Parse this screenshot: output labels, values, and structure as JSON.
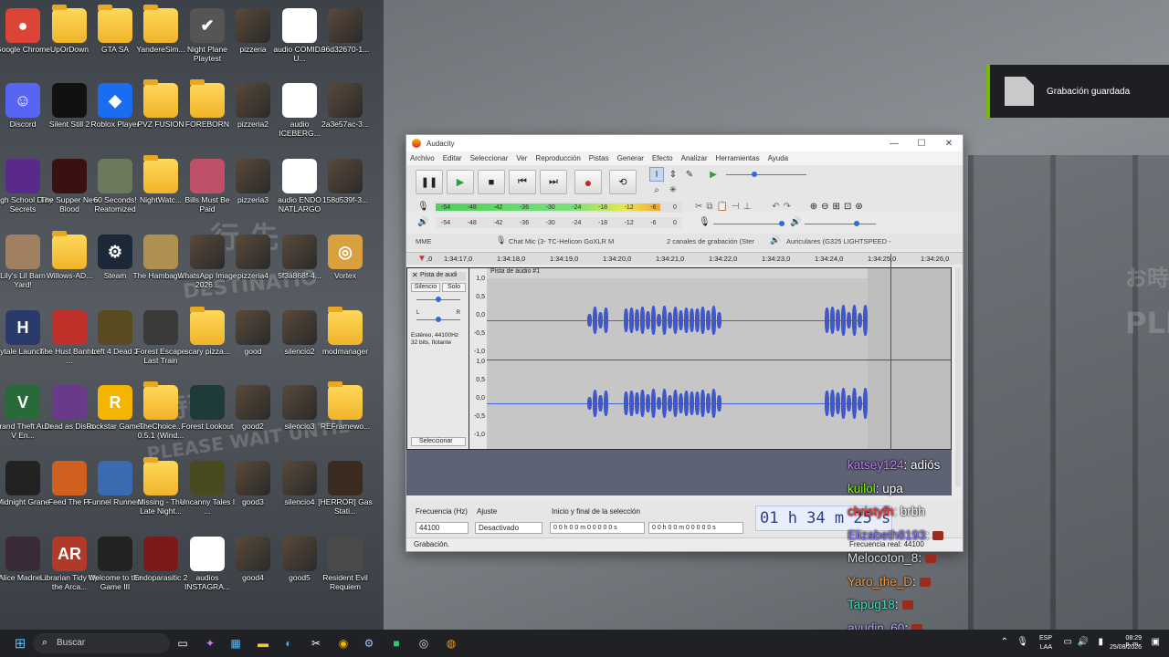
{
  "wallpaper": {
    "sign_1": "行 先",
    "sign_2": "DESTINATIO",
    "sign_3": "PLEASE WAIT UNTIL",
    "sign_4": "時刻",
    "sign_5": "PLE",
    "sign_6": "お時"
  },
  "desktop_icons": [
    {
      "label": "Google Chrome",
      "icon": "chrome-icon",
      "glyph": "●",
      "color": "#db4437"
    },
    {
      "label": "UpOrDown",
      "icon": "folder-icon",
      "glyph": "",
      "color": ""
    },
    {
      "label": "GTA SA",
      "icon": "folder-icon",
      "glyph": "",
      "color": ""
    },
    {
      "label": "YandereSim...",
      "icon": "folder-icon",
      "glyph": "",
      "color": ""
    },
    {
      "label": "Night Plane Playtest",
      "icon": "checkmark-icon",
      "glyph": "✔",
      "color": "#555555"
    },
    {
      "label": "pizzeria",
      "icon": "image-thumbnail-icon",
      "glyph": "",
      "color": ""
    },
    {
      "label": "audio COMIDA U...",
      "icon": "media-file-icon",
      "glyph": "▶",
      "color": ""
    },
    {
      "label": "96d32670-1...",
      "icon": "image-thumbnail-icon",
      "glyph": "",
      "color": ""
    },
    {
      "label": "Discord",
      "icon": "discord-icon",
      "glyph": "☺",
      "color": "#5865f2"
    },
    {
      "label": "Silent Still 2",
      "icon": "game-icon",
      "glyph": "",
      "color": "#111111"
    },
    {
      "label": "Roblox Player",
      "icon": "roblox-icon",
      "glyph": "◆",
      "color": "#1a6cf0"
    },
    {
      "label": "PVZ FUSION",
      "icon": "folder-icon",
      "glyph": "",
      "color": ""
    },
    {
      "label": "FOREBORN",
      "icon": "folder-icon",
      "glyph": "",
      "color": ""
    },
    {
      "label": "pizzeria2",
      "icon": "image-thumbnail-icon",
      "glyph": "",
      "color": ""
    },
    {
      "label": "audio ICEBERG...",
      "icon": "media-file-icon",
      "glyph": "▶",
      "color": ""
    },
    {
      "label": "2a3e57ac-3...",
      "icon": "image-thumbnail-icon",
      "glyph": "",
      "color": ""
    },
    {
      "label": "High School Dirty Secrets",
      "icon": "game-icon",
      "glyph": "",
      "color": "#5a2a8a"
    },
    {
      "label": "The Supper New Blood",
      "icon": "game-icon",
      "glyph": "",
      "color": "#3a1010"
    },
    {
      "label": "60 Seconds! Reatomized",
      "icon": "game-icon",
      "glyph": "",
      "color": "#6a7a5a"
    },
    {
      "label": "NightWatc...",
      "icon": "folder-icon",
      "glyph": "",
      "color": ""
    },
    {
      "label": "Bills Must Be Paid",
      "icon": "game-icon",
      "glyph": "",
      "color": "#c0506a"
    },
    {
      "label": "pizzeria3",
      "icon": "image-thumbnail-icon",
      "glyph": "",
      "color": ""
    },
    {
      "label": "audio ENDO NATLARGO",
      "icon": "media-file-icon",
      "glyph": "▶",
      "color": ""
    },
    {
      "label": "158d539f-3...",
      "icon": "image-thumbnail-icon",
      "glyph": "",
      "color": ""
    },
    {
      "label": "Lily's Lil Barn Yard!",
      "icon": "game-icon",
      "glyph": "",
      "color": "#a08060"
    },
    {
      "label": "Willows-AD...",
      "icon": "folder-icon",
      "glyph": "",
      "color": ""
    },
    {
      "label": "Steam",
      "icon": "steam-icon",
      "glyph": "⚙",
      "color": "#1b2838"
    },
    {
      "label": "The Hambagu...",
      "icon": "game-icon",
      "glyph": "",
      "color": "#b09050"
    },
    {
      "label": "WhatsApp Image 2026...",
      "icon": "image-thumbnail-icon",
      "glyph": "",
      "color": ""
    },
    {
      "label": "pizzeria4",
      "icon": "image-thumbnail-icon",
      "glyph": "",
      "color": ""
    },
    {
      "label": "5f3a868f-4...",
      "icon": "image-thumbnail-icon",
      "glyph": "",
      "color": ""
    },
    {
      "label": "Vortex",
      "icon": "vortex-icon",
      "glyph": "◎",
      "color": "#d9a040"
    },
    {
      "label": "Hytale Launcher",
      "icon": "game-icon",
      "glyph": "H",
      "color": "#2a3a6a"
    },
    {
      "label": "The Hust Banhmi ...",
      "icon": "game-icon",
      "glyph": "",
      "color": "#c0302a"
    },
    {
      "label": "Left 4 Dead 2",
      "icon": "game-icon",
      "glyph": "",
      "color": "#5a4a20"
    },
    {
      "label": "Forest Escape Last Train",
      "icon": "game-icon",
      "glyph": "",
      "color": "#3a3a3a"
    },
    {
      "label": "scary pizza...",
      "icon": "folder-icon",
      "glyph": "",
      "color": ""
    },
    {
      "label": "good",
      "icon": "image-thumbnail-icon",
      "glyph": "",
      "color": ""
    },
    {
      "label": "silencio2",
      "icon": "image-thumbnail-icon",
      "glyph": "",
      "color": ""
    },
    {
      "label": "modmanager",
      "icon": "folder-icon",
      "glyph": "",
      "color": ""
    },
    {
      "label": "Grand Theft Auto V En...",
      "icon": "game-icon",
      "glyph": "V",
      "color": "#2a6a3a"
    },
    {
      "label": "Dead as Disco",
      "icon": "game-icon",
      "glyph": "",
      "color": "#6a3a8a"
    },
    {
      "label": "Rockstar Games",
      "icon": "rockstar-icon",
      "glyph": "R",
      "color": "#f3b500"
    },
    {
      "label": "TheChoice... 0.5.1 (Wind...",
      "icon": "folder-icon",
      "glyph": "",
      "color": ""
    },
    {
      "label": "Forest Lookout",
      "icon": "game-icon",
      "glyph": "",
      "color": "#1f3a3a"
    },
    {
      "label": "good2",
      "icon": "image-thumbnail-icon",
      "glyph": "",
      "color": ""
    },
    {
      "label": "silencio3",
      "icon": "image-thumbnail-icon",
      "glyph": "",
      "color": ""
    },
    {
      "label": "REFramewo...",
      "icon": "folder-icon",
      "glyph": "",
      "color": ""
    },
    {
      "label": "Midnight Grane",
      "icon": "game-icon",
      "glyph": "",
      "color": "#222222"
    },
    {
      "label": "Feed The Pi",
      "icon": "game-icon",
      "glyph": "",
      "color": "#d06020"
    },
    {
      "label": "Funnel Runners",
      "icon": "game-icon",
      "glyph": "",
      "color": "#3a6ab0"
    },
    {
      "label": "Missing - The Late Night...",
      "icon": "folder-icon",
      "glyph": "",
      "color": ""
    },
    {
      "label": "Uncanny Tales I ...",
      "icon": "game-icon",
      "glyph": "",
      "color": "#4a4a20"
    },
    {
      "label": "good3",
      "icon": "image-thumbnail-icon",
      "glyph": "",
      "color": ""
    },
    {
      "label": "silencio4",
      "icon": "image-thumbnail-icon",
      "glyph": "",
      "color": ""
    },
    {
      "label": "[HERROR] Gas Stati...",
      "icon": "game-icon",
      "glyph": "",
      "color": "#3a2a20"
    },
    {
      "label": "Alice Madne...",
      "icon": "game-icon",
      "glyph": "",
      "color": "#3a2a3a"
    },
    {
      "label": "Librarian Tidy Up the Arca...",
      "icon": "game-icon",
      "glyph": "AR",
      "color": "#b03a2a"
    },
    {
      "label": "Welcome to the Game III",
      "icon": "game-icon",
      "glyph": "",
      "color": "#222222"
    },
    {
      "label": "Endoparasitic 2",
      "icon": "game-icon",
      "glyph": "",
      "color": "#7a1a1a"
    },
    {
      "label": "audios INSTAGRA...",
      "icon": "media-file-icon",
      "glyph": "▶",
      "color": ""
    },
    {
      "label": "good4",
      "icon": "image-thumbnail-icon",
      "glyph": "",
      "color": ""
    },
    {
      "label": "good5",
      "icon": "image-thumbnail-icon",
      "glyph": "",
      "color": ""
    },
    {
      "label": "Resident Evil Requiem",
      "icon": "game-icon",
      "glyph": "",
      "color": "#4a4a4a"
    }
  ],
  "notification": {
    "text": "Grabación guardada"
  },
  "audacity": {
    "title": "Audacity",
    "menu": [
      "Archivo",
      "Editar",
      "Seleccionar",
      "Ver",
      "Reproducción",
      "Pistas",
      "Generar",
      "Efecto",
      "Analizar",
      "Herramientas",
      "Ayuda"
    ],
    "meter_ticks": [
      "-54",
      "-48",
      "-42",
      "-36",
      "-30",
      "-24",
      "-18",
      "-12",
      "-6",
      "0"
    ],
    "rec_meter_level": 0.91,
    "host": "MME",
    "input_device": "Chat Mic (3- TC-Helicon GoXLR M",
    "channels": "2 canales de grabación (Ster",
    "output_device": "Auriculares (G325 LIGHTSPEED -",
    "ruler_ticks": [
      ",0",
      "1:34:17,0",
      "1:34:18,0",
      "1:34:19,0",
      "1:34:20,0",
      "1:34:21,0",
      "1:34:22,0",
      "1:34:23,0",
      "1:34:24,0",
      "1:34:25,0",
      "1:34:26,0"
    ],
    "track": {
      "name": "Pista de audi",
      "mute": "Silencio",
      "solo": "Solo",
      "info_1": "Estéreo, 44100Hz",
      "info_2": "32 bits, flotante",
      "select": "Seleccionar",
      "clip_name": "Pista de audio #1",
      "scale": [
        "1,0",
        "0,5",
        "0,0",
        "-0,5",
        "-1,0"
      ]
    },
    "selection_toolbar": {
      "rate_label": "Frecuencia (Hz)",
      "rate_value": "44100",
      "snap_label": "Ajuste",
      "snap_value": "Desactivado",
      "range_label": "Inicio y final de la selección",
      "start": "0 0 h 0 0 m 0 0 0 0 0 s",
      "end": "0 0 h 0 0 m 0 0 0 0 0 s"
    },
    "time_display": "01 h 34 m 25 s",
    "status": "Grabación.",
    "actual_rate": "Frecuencia real: 44100"
  },
  "chat": [
    {
      "user": "katsey124",
      "text": ": adiós",
      "color": "#c77dff"
    },
    {
      "user": "kuilol",
      "text": ": upa",
      "color": "#7cfc00"
    },
    {
      "user": "christyfh",
      "text": ": brbh",
      "color": "#ff3b3b"
    },
    {
      "user": "Elizabeth8193",
      "text": ":",
      "color": "#8a7bff"
    },
    {
      "user": "Melocoton_8",
      "text": ":",
      "color": "#dddddd"
    },
    {
      "user": "Yaro_the_D",
      "text": ":",
      "color": "#ff9a3c"
    },
    {
      "user": "Tapug18",
      "text": ":",
      "color": "#49e0c0"
    },
    {
      "user": "ayudin_60",
      "text": ":",
      "color": "#b6a6ff"
    }
  ],
  "taskbar": {
    "search_placeholder": "Buscar",
    "lang_1": "ESP",
    "lang_2": "LAA",
    "time": "08:29 p. m.",
    "date": "25/08/2026"
  }
}
